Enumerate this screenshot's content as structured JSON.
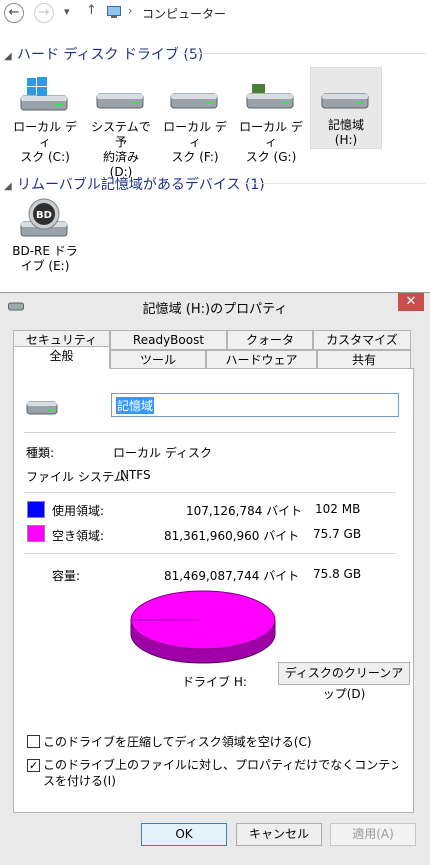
{
  "explorer": {
    "nav": {
      "back_icon": "←",
      "forward_icon": "→",
      "recent_icon": "▾",
      "up_icon": "↑",
      "sep_icon": "›"
    },
    "breadcrumb": "コンピューター",
    "hard_disk_section": "ハード ディスク ドライブ (5)",
    "removable_section": "リムーバブル記憶域があるデバイス (1)",
    "drives": [
      {
        "line1": "ローカル ディ",
        "line2": "スク (C:)",
        "line3": ""
      },
      {
        "line1": "システムで予",
        "line2": "約済み",
        "line3": "(D:)"
      },
      {
        "line1": "ローカル ディ",
        "line2": "スク (F:)",
        "line3": ""
      },
      {
        "line1": "ローカル ディ",
        "line2": "スク (G:)",
        "line3": ""
      },
      {
        "line1": "記憶域",
        "line2": "(H:)",
        "line3": ""
      }
    ],
    "bd_drive": {
      "line1": "BD-RE ドラ",
      "line2": "イブ (E:)",
      "badge": "BD"
    }
  },
  "dialog": {
    "title": "記憶域 (H:)のプロパティ",
    "close_icon": "✕",
    "tabs_back": [
      "セキュリティ",
      "ReadyBoost",
      "クォータ",
      "カスタマイズ"
    ],
    "tabs_front": [
      "全般",
      "ツール",
      "ハードウェア",
      "共有"
    ],
    "name_value": "記憶域",
    "type_label": "種類:",
    "type_value": "ローカル ディスク",
    "fs_label": "ファイル システム:",
    "fs_value": "NTFS",
    "used_label": "使用領域:",
    "used_bytes": "107,126,784 バイト",
    "used_size": "102 MB",
    "free_label": "空き領域:",
    "free_bytes": "81,361,960,960 バイト",
    "free_size": "75.7 GB",
    "cap_label": "容量:",
    "cap_bytes": "81,469,087,744 バイト",
    "cap_size": "75.8 GB",
    "drive_label": "ドライブ H:",
    "cleanup_button": "ディスクのクリーンアップ(D)",
    "compress_label": "このドライブを圧縮してディスク領域を空ける(C)",
    "index_label_1": "このドライブ上のファイルに対し、プロパティだけでなくコンテンツにもインデック",
    "index_label_2": "スを付ける(I)",
    "compress_checked": false,
    "index_checked": true,
    "check_mark": "✓",
    "ok_button": "OK",
    "cancel_button": "キャンセル",
    "apply_button": "適用(A)",
    "colors": {
      "used": "#0000ff",
      "free": "#ff00ff",
      "free_side": "#a000a8"
    },
    "usage": {
      "used_bytes": 107126784,
      "free_bytes": 81361960960,
      "total_bytes": 81469087744
    }
  }
}
